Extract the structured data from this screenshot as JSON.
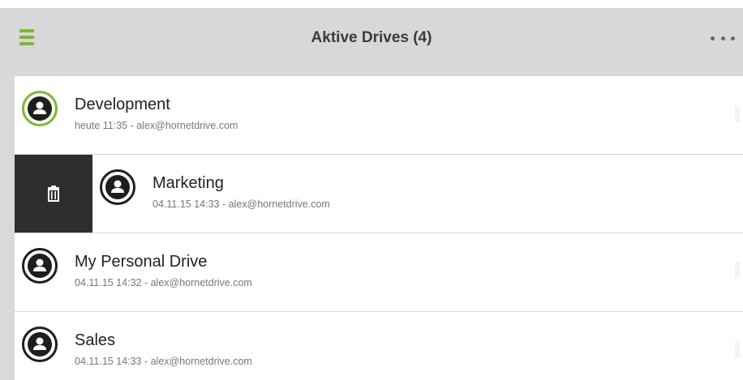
{
  "header": {
    "title": "Aktive Drives (4)",
    "menu_icon": "hamburger-menu-icon",
    "more_icon": "more-options-icon",
    "accent_color": "#7cb82f"
  },
  "drives": [
    {
      "name": "Development",
      "meta": "heute 11:35 - alex@hornetdrive.com",
      "active": true,
      "icon": "user-icon"
    },
    {
      "name": "Marketing",
      "meta": "04.11.15 14:33 - alex@hornetdrive.com",
      "active": false,
      "swiped": true,
      "delete_icon": "trash-icon",
      "icon": "user-icon"
    },
    {
      "name": "My Personal Drive",
      "meta": "04.11.15 14:32 - alex@hornetdrive.com",
      "active": false,
      "icon": "user-icon"
    },
    {
      "name": "Sales",
      "meta": "04.11.15 14:33 - alex@hornetdrive.com",
      "active": false,
      "icon": "user-icon"
    }
  ]
}
